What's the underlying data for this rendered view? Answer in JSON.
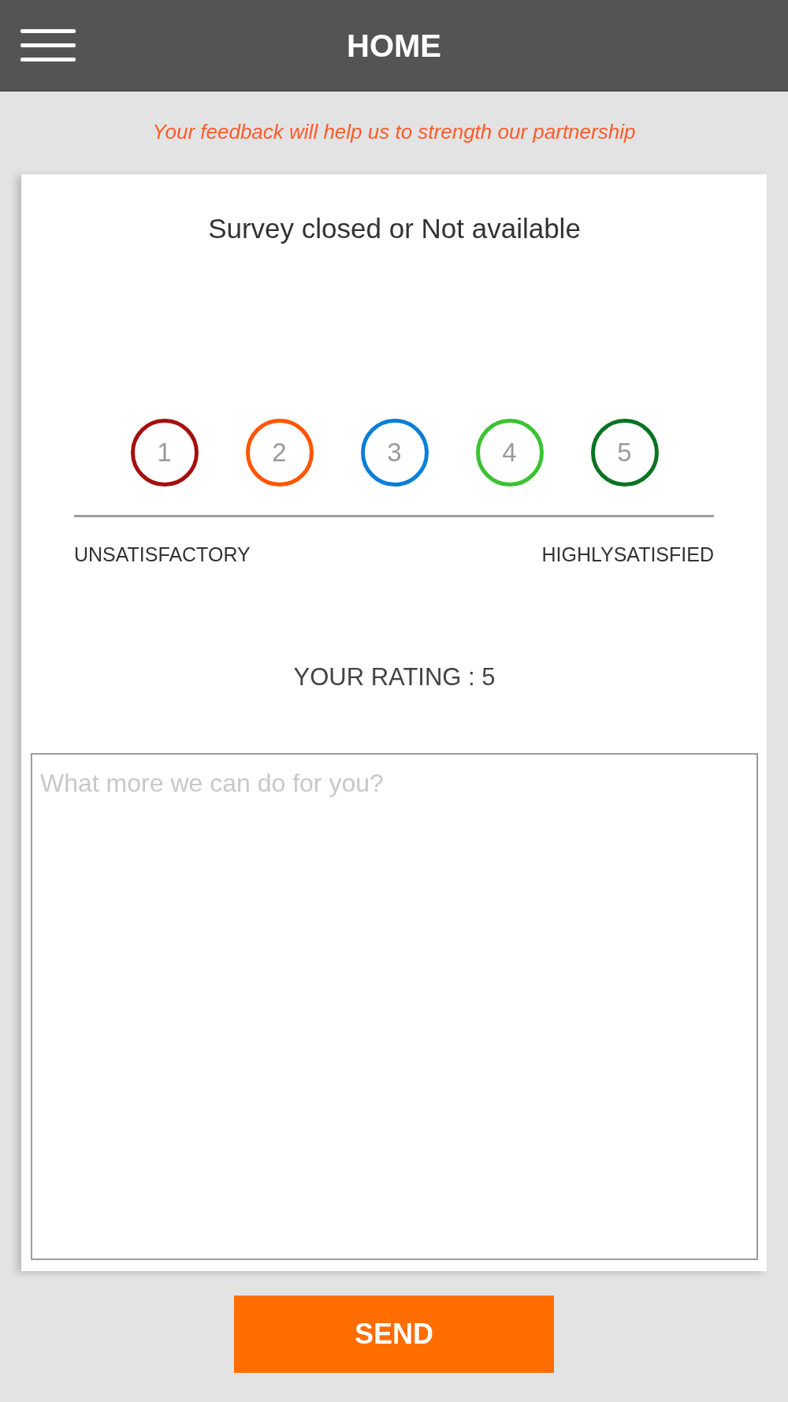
{
  "header": {
    "title": "HOME"
  },
  "tagline": "Your feedback will help us to strength our partnership",
  "survey": {
    "status": "Survey closed or Not available",
    "rating_options": [
      {
        "label": "1",
        "color": "#a50f0f"
      },
      {
        "label": "2",
        "color": "#ff5500"
      },
      {
        "label": "3",
        "color": "#0a7fd8"
      },
      {
        "label": "4",
        "color": "#3cc232"
      },
      {
        "label": "5",
        "color": "#0a7323"
      }
    ],
    "scale_labels": {
      "low": "UNSATISFACTORY",
      "high": "HIGHLYSATISFIED"
    },
    "rating_text": "YOUR RATING : 5",
    "comment": {
      "placeholder": "What more we can do for you?"
    }
  },
  "buttons": [
    {
      "label": "SEND"
    }
  ]
}
